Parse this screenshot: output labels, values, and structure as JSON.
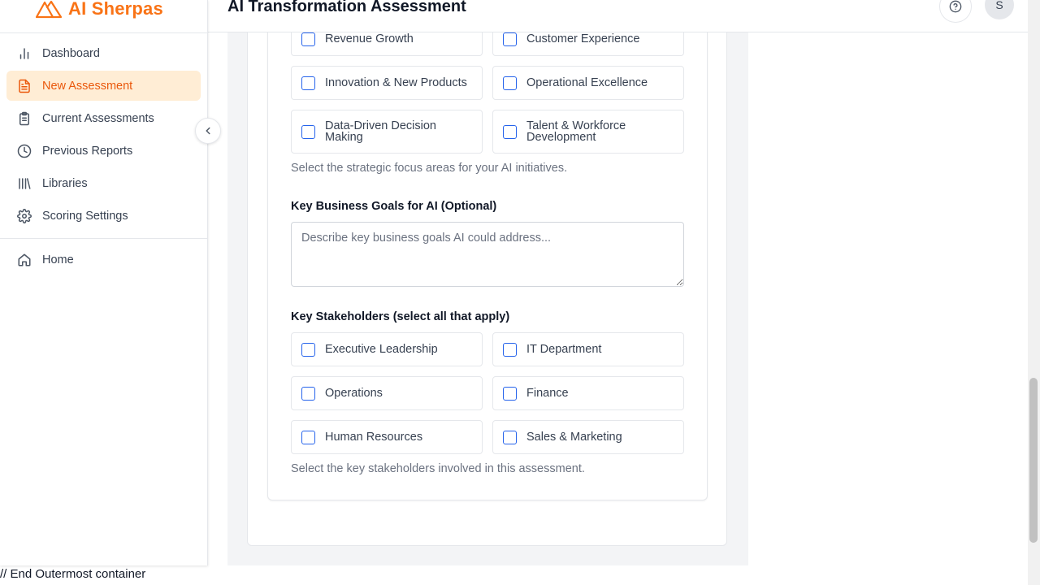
{
  "brand": {
    "name": "AI Sherpas",
    "accent": "#f97316"
  },
  "header": {
    "title": "AI Transformation Assessment",
    "avatar_initial": "S"
  },
  "sidebar": {
    "items": [
      {
        "label": "Dashboard",
        "icon": "bar-chart-icon"
      },
      {
        "label": "New Assessment",
        "icon": "document-icon",
        "active": true
      },
      {
        "label": "Current Assessments",
        "icon": "clipboard-icon"
      },
      {
        "label": "Previous Reports",
        "icon": "clock-icon"
      },
      {
        "label": "Libraries",
        "icon": "library-icon"
      },
      {
        "label": "Scoring Settings",
        "icon": "gear-icon"
      }
    ],
    "home": {
      "label": "Home",
      "icon": "home-icon"
    }
  },
  "focus_areas": {
    "options": [
      "Revenue Growth",
      "Customer Experience",
      "Innovation & New Products",
      "Operational Excellence",
      "Data-Driven Decision Making",
      "Talent & Workforce Development"
    ],
    "help": "Select the strategic focus areas for your AI initiatives."
  },
  "goals": {
    "label": "Key Business Goals for AI (Optional)",
    "placeholder": "Describe key business goals AI could address...",
    "value": ""
  },
  "stakeholders": {
    "label": "Key Stakeholders (select all that apply)",
    "options": [
      "Executive Leadership",
      "IT Department",
      "Operations",
      "Finance",
      "Human Resources",
      "Sales & Marketing"
    ],
    "help": "Select the key stakeholders involved in this assessment."
  },
  "footer_text": "// End Outermost container"
}
